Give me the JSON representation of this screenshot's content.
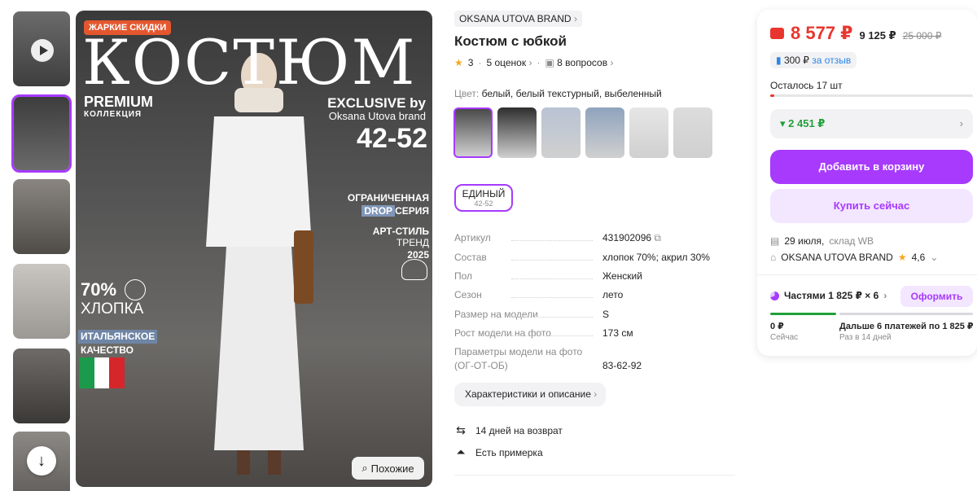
{
  "gallery": {
    "thumbnails": [
      {
        "kind": "video",
        "color": "#5b5b5b"
      },
      {
        "kind": "image",
        "color": "#4c4c4c",
        "selected": true
      },
      {
        "kind": "image",
        "color": "#6e6a66"
      },
      {
        "kind": "image",
        "color": "#b9b6b3"
      },
      {
        "kind": "image",
        "color": "#55524f"
      },
      {
        "kind": "image",
        "color": "#7b7874"
      }
    ],
    "main_image": {
      "badge": "ЖАРКИЕ СКИДКИ",
      "headline": "КОСТЮМ",
      "premium": "PREMIUM",
      "collection": "КОЛЛЕКЦИЯ",
      "exclusive": "EXCLUSIVE by",
      "brand_line": "Oksana Utova brand",
      "sizes": "42-52",
      "limited": "ОГРАНИЧЕННАЯ",
      "drop": "DROP",
      "series": "СЕРИЯ",
      "art_style": "АРТ-СТИЛЬ",
      "trend": "ТРЕНД",
      "year": "2025",
      "cotton_pct": "70%",
      "cotton": "ХЛОПКА",
      "italian_1": "ИТАЛЬЯНСКОЕ",
      "italian_2": "КАЧЕСТВО"
    },
    "similar_label": "Похожие"
  },
  "product": {
    "brand": "OKSANA UTOVA BRAND",
    "title": "Костюм с юбкой",
    "rating": "3",
    "reviews": "5 оценок",
    "questions": "8 вопросов",
    "color_label": "Цвет:",
    "color_value": "белый, белый текстурный, выбеленный",
    "swatch_colors": [
      "#4a4a4a",
      "#2e2e2e",
      "#b8c3d3",
      "#8fa3bd",
      "#e6e6e6",
      "#dcdcdc"
    ],
    "size": {
      "name": "ЕДИНЫЙ",
      "range": "42-52"
    },
    "properties": [
      {
        "key": "Артикул",
        "value": "431902096"
      },
      {
        "key": "Состав",
        "value": "хлопок 70%; акрил 30%"
      },
      {
        "key": "Пол",
        "value": "Женский"
      },
      {
        "key": "Сезон",
        "value": "лето"
      },
      {
        "key": "Размер на модели",
        "value": "S"
      },
      {
        "key": "Рост модели на фото",
        "value": "173 см"
      },
      {
        "key": "Параметры модели на фото",
        "key2": "(ОГ-ОТ-ОБ)",
        "value": "83-62-92"
      }
    ],
    "chars_button": "Характеристики и описание",
    "features": [
      {
        "icon": "return-icon",
        "text": "14 дней на возврат"
      },
      {
        "icon": "hanger-icon",
        "text": "Есть примерка"
      }
    ]
  },
  "buy_card": {
    "price": "8 577 ₽",
    "price_without_wallet": "9 125 ₽",
    "old_price": "25 000 ₽",
    "bonus_amount": "300 ₽",
    "bonus_text": "за отзыв",
    "stock_left": "Осталось 17 шт",
    "stock_fraction": 0.02,
    "discount": "2 451 ₽",
    "add_to_cart": "Добавить в корзину",
    "buy_now": "Купить сейчас",
    "delivery_date": "29 июля,",
    "warehouse": "склад WB",
    "seller": "OKSANA UTOVA BRAND",
    "seller_rating": "4,6",
    "installments": "Частями 1 825 ₽ × 6",
    "apply": "Оформить",
    "now_amount": "0 ₽",
    "now_label": "Сейчас",
    "later_amount": "Дальше 6 платежей по 1 825 ₽",
    "later_label": "Раз в 14 дней",
    "colors": {
      "accent": "#a73afd",
      "price": "#e8362f",
      "green": "#21a038"
    }
  }
}
